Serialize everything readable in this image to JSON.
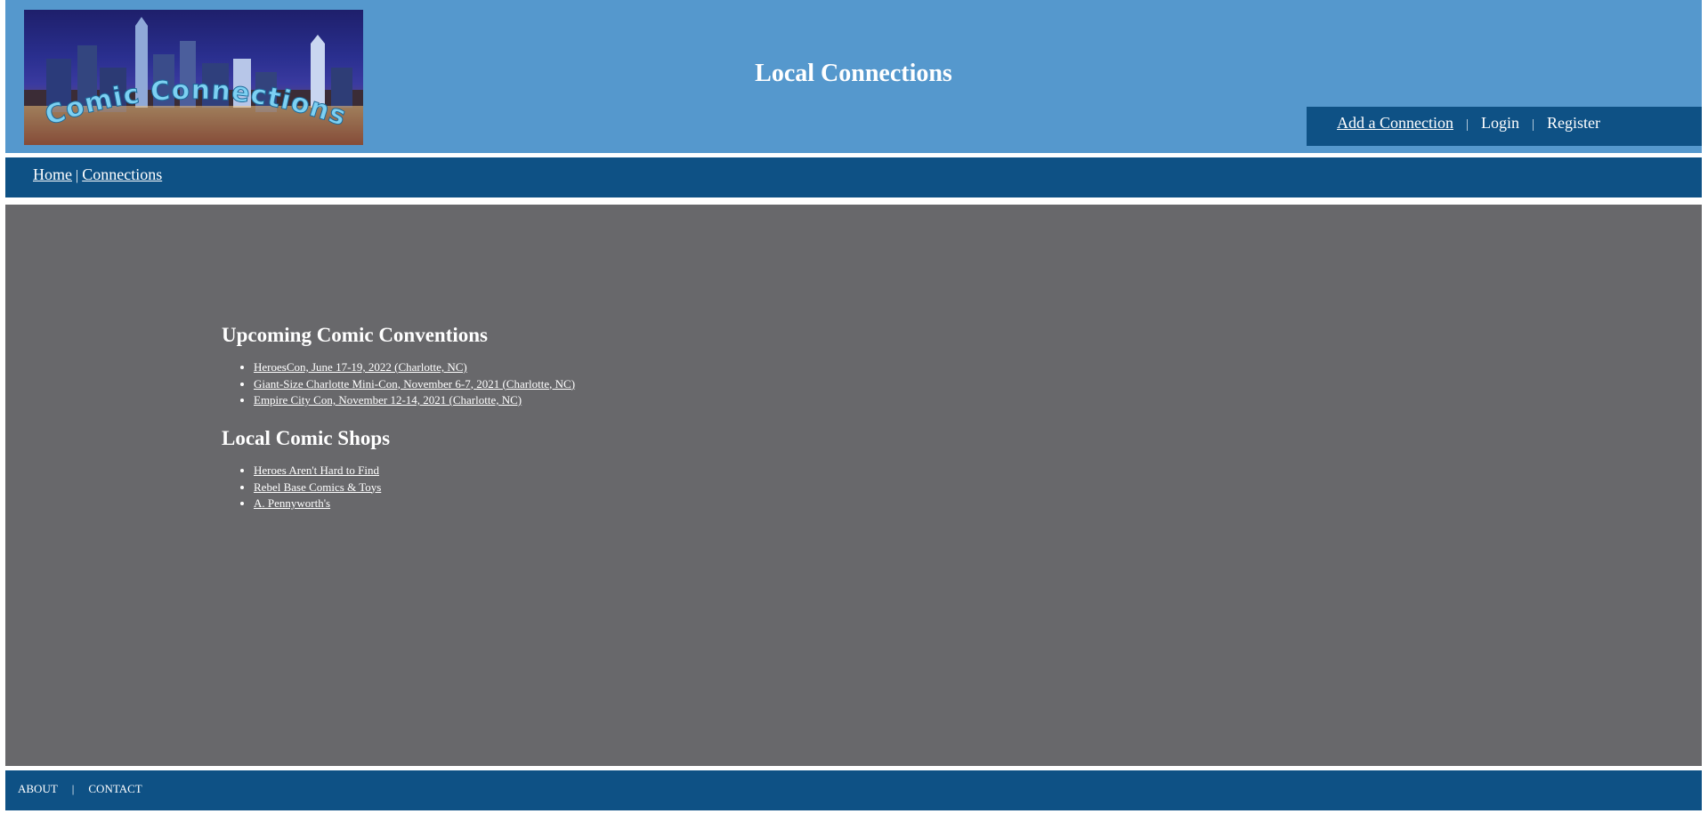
{
  "header": {
    "logo_text": "Comic Connections",
    "title": "Local Connections"
  },
  "user_nav": {
    "add_connection": "Add a Connection",
    "separator": "|",
    "login": "Login",
    "register": "Register"
  },
  "main_nav": {
    "home": "Home",
    "separator": "|",
    "connections": "Connections"
  },
  "sections": {
    "conventions": {
      "heading": "Upcoming Comic Conventions",
      "items": [
        "HeroesCon, June 17-19, 2022 (Charlotte, NC)",
        "Giant-Size Charlotte Mini-Con, November 6-7, 2021 (Charlotte, NC)",
        "Empire City Con, November 12-14, 2021 (Charlotte, NC)"
      ]
    },
    "shops": {
      "heading": "Local Comic Shops",
      "items": [
        "Heroes Aren't Hard to Find",
        "Rebel Base Comics & Toys",
        "A. Pennyworth's"
      ]
    }
  },
  "footer": {
    "about": "ABOUT",
    "separator": "|",
    "contact": "CONTACT"
  },
  "colors": {
    "header_bg": "#5598cd",
    "nav_bg": "#0e5185",
    "content_bg": "#68686b",
    "text": "#ffffff"
  }
}
